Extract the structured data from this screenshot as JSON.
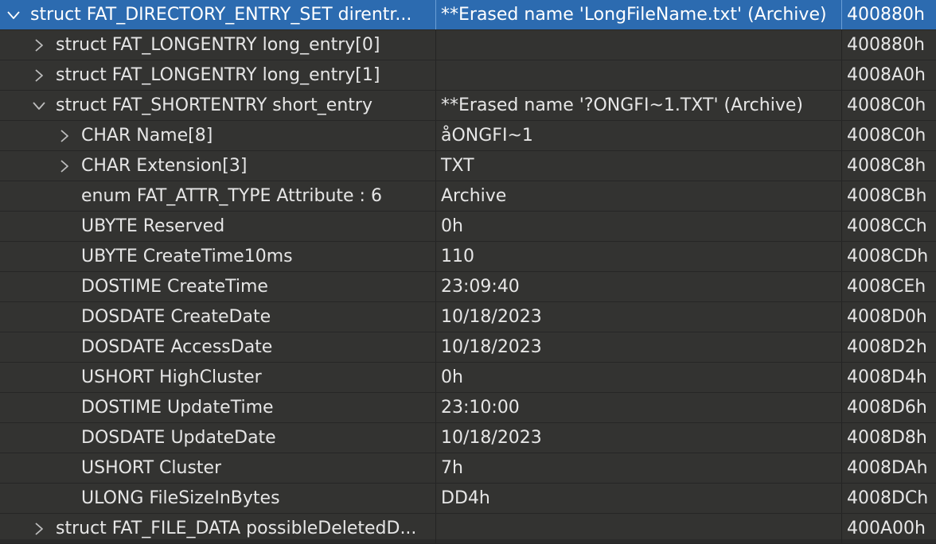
{
  "columns": [
    "Name",
    "Value",
    "Start"
  ],
  "rows": [
    {
      "name": "struct FAT_DIRECTORY_ENTRY_SET direntr...",
      "value": "**Erased name 'LongFileName.txt' (Archive)",
      "start": "400880h",
      "expander": "chevron-down-icon",
      "level": 0,
      "selected": true
    },
    {
      "name": "struct FAT_LONGENTRY long_entry[0]",
      "value": "",
      "start": "400880h",
      "expander": "chevron-right-icon",
      "level": 1,
      "selected": false
    },
    {
      "name": "struct FAT_LONGENTRY long_entry[1]",
      "value": "",
      "start": "4008A0h",
      "expander": "chevron-right-icon",
      "level": 1,
      "selected": false
    },
    {
      "name": "struct FAT_SHORTENTRY short_entry",
      "value": "**Erased name '?ONGFI~1.TXT' (Archive)",
      "start": "4008C0h",
      "expander": "chevron-down-icon",
      "level": 1,
      "selected": false
    },
    {
      "name": "CHAR Name[8]",
      "value": "åONGFI~1",
      "start": "4008C0h",
      "expander": "chevron-right-icon",
      "level": 2,
      "selected": false
    },
    {
      "name": "CHAR Extension[3]",
      "value": "TXT",
      "start": "4008C8h",
      "expander": "chevron-right-icon",
      "level": 2,
      "selected": false
    },
    {
      "name": "enum FAT_ATTR_TYPE Attribute : 6",
      "value": "Archive",
      "start": "4008CBh",
      "expander": "",
      "level": 2,
      "selected": false
    },
    {
      "name": "UBYTE Reserved",
      "value": "0h",
      "start": "4008CCh",
      "expander": "",
      "level": 2,
      "selected": false
    },
    {
      "name": "UBYTE CreateTime10ms",
      "value": "110",
      "start": "4008CDh",
      "expander": "",
      "level": 2,
      "selected": false
    },
    {
      "name": "DOSTIME CreateTime",
      "value": "23:09:40",
      "start": "4008CEh",
      "expander": "",
      "level": 2,
      "selected": false
    },
    {
      "name": "DOSDATE CreateDate",
      "value": "10/18/2023",
      "start": "4008D0h",
      "expander": "",
      "level": 2,
      "selected": false
    },
    {
      "name": "DOSDATE AccessDate",
      "value": "10/18/2023",
      "start": "4008D2h",
      "expander": "",
      "level": 2,
      "selected": false
    },
    {
      "name": "USHORT HighCluster",
      "value": "0h",
      "start": "4008D4h",
      "expander": "",
      "level": 2,
      "selected": false
    },
    {
      "name": "DOSTIME UpdateTime",
      "value": "23:10:00",
      "start": "4008D6h",
      "expander": "",
      "level": 2,
      "selected": false
    },
    {
      "name": "DOSDATE UpdateDate",
      "value": "10/18/2023",
      "start": "4008D8h",
      "expander": "",
      "level": 2,
      "selected": false
    },
    {
      "name": "USHORT Cluster",
      "value": "7h",
      "start": "4008DAh",
      "expander": "",
      "level": 2,
      "selected": false
    },
    {
      "name": "ULONG FileSizeInBytes",
      "value": "DD4h",
      "start": "4008DCh",
      "expander": "",
      "level": 2,
      "selected": false
    },
    {
      "name": "struct FAT_FILE_DATA possibleDeletedD...",
      "value": "",
      "start": "400A00h",
      "expander": "chevron-right-icon",
      "level": 1,
      "selected": false
    }
  ],
  "colors": {
    "background": "#333331",
    "selected_row": "#2c6bb0",
    "text": "#e6e6e6",
    "chevron": "#bdbdbd"
  }
}
